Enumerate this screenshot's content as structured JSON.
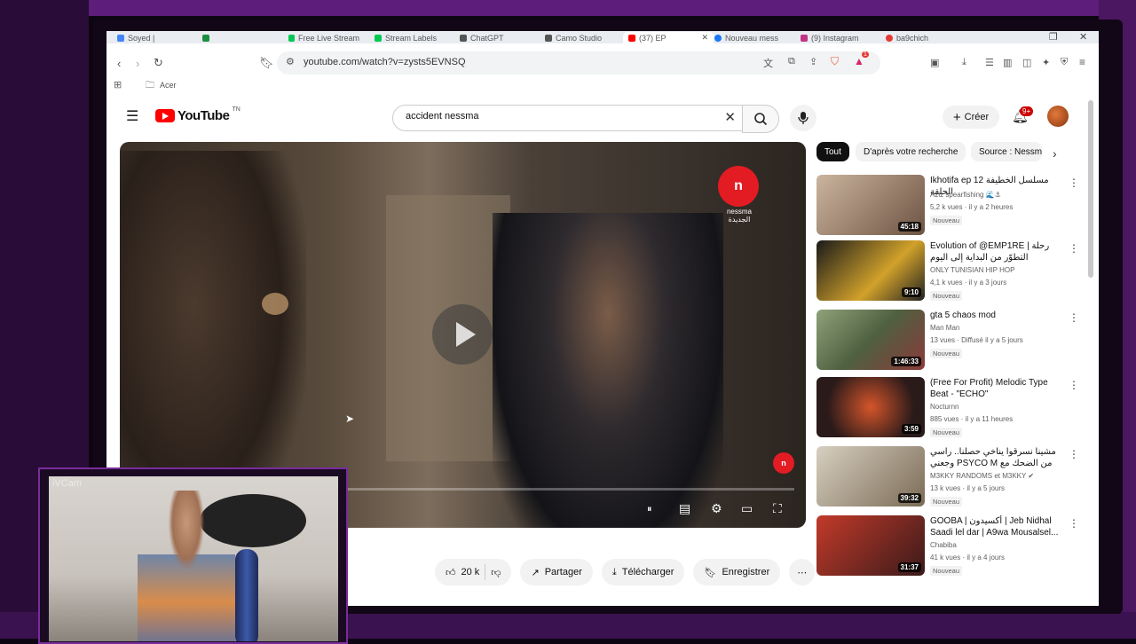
{
  "browser": {
    "tabs": [
      {
        "label": "Soyed |",
        "color": "#4285f4"
      },
      {
        "label": "",
        "color": "#1e8e3e"
      },
      {
        "label": "Free Live Stream",
        "color": "#00c853"
      },
      {
        "label": "Stream Labels",
        "color": "#00c853"
      },
      {
        "label": "ChatGPT",
        "color": "#333333"
      },
      {
        "label": "Camo Studio",
        "color": "#333333"
      },
      {
        "label": "(37) EP",
        "color": "#ff0000"
      },
      {
        "label": "Nouveau mess",
        "color": "#1877f2"
      },
      {
        "label": "(9) Instagram",
        "color": "#c13584"
      },
      {
        "label": "ba9chich",
        "color": "#e53935"
      }
    ],
    "url": "youtube.com/watch?v=zysts5EVNSQ",
    "bookmark_folder": "Acer",
    "shield_badge": "1"
  },
  "youtube": {
    "logo_text": "YouTube",
    "region": "TN",
    "search_value": "accident nessma",
    "create_label": "Créer",
    "notif_count": "9+"
  },
  "video": {
    "channel_logo_text": "n",
    "channel_name": "nessma الجديدة",
    "likes": "20 k",
    "share_label": "Partager",
    "download_label": "Télécharger",
    "save_label": "Enregistrer"
  },
  "chips": [
    "Tout",
    "D'après votre recherche",
    "Source : Nessma"
  ],
  "related": [
    {
      "title": "Ikhotifa ep 12 مسلسل الخطيفة الحلقة",
      "channel": "Aziz spearfishing 🌊⚓",
      "meta": "5,2 k vues · il y a 2 heures",
      "duration": "45:18",
      "badge": "Nouveau",
      "thumb": "#b89a7e"
    },
    {
      "title": "Evolution of @EMP1RE | رحلة التطوّر من البداية إلى اليوم",
      "channel": "ONLY TUNISIAN HIP HOP",
      "meta": "4,1 k vues · il y a 3 jours",
      "duration": "9:10",
      "badge": "Nouveau",
      "thumb": "#d1a12a"
    },
    {
      "title": "gta 5 chaos mod",
      "channel": "Man Man",
      "meta": "13 vues · Diffusé il y a 5 jours",
      "duration": "1:46:33",
      "badge": "Nouveau",
      "thumb": "#6f8a58"
    },
    {
      "title": "(Free For Profit) Melodic Type Beat - \"ECHO\"",
      "channel": "Nocturnn",
      "meta": "885 vues · il y a 11 heures",
      "duration": "3:59",
      "badge": "Nouveau",
      "thumb": "#8a3b2a"
    },
    {
      "title": "مشينا نسرقوا يناخي حصلنا.. راسي وجعني PSYCO M من الضحك مع",
      "channel": "M3KKY RANDOMS et M3KKY ✔",
      "meta": "13 k vues · il y a 5 jours",
      "duration": "39:32",
      "badge": "Nouveau",
      "thumb": "#a8a090"
    },
    {
      "title": "GOOBA | أكسيدون | Jeb Nidhal Saadi lel dar | A9wa Mousalsel...",
      "channel": "Chabiba",
      "meta": "41 k vues · il y a 4 jours",
      "duration": "31:37",
      "badge": "Nouveau",
      "thumb": "#c23a2a"
    }
  ],
  "webcam": {
    "label": "iVCam"
  }
}
